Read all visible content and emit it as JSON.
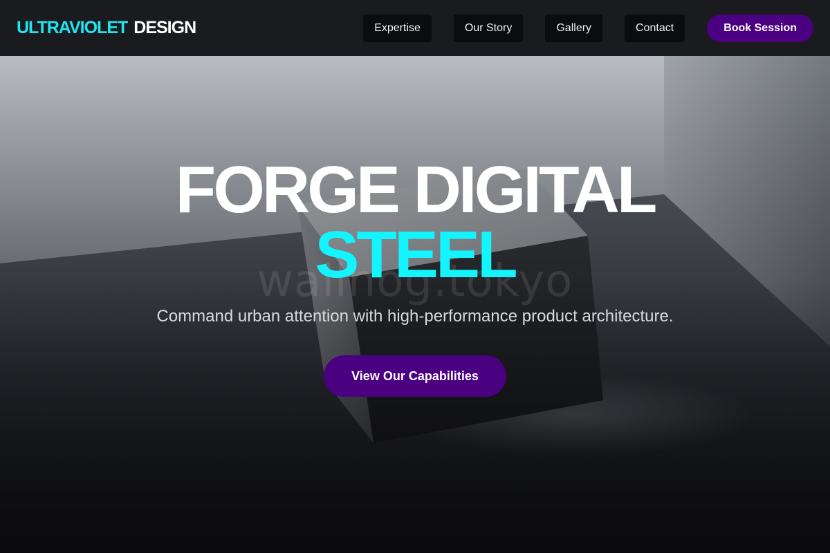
{
  "header": {
    "logo_accent": "ULTRAVIOLET",
    "logo_main": "DESIGN",
    "nav": [
      "Expertise",
      "Our Story",
      "Gallery",
      "Contact"
    ],
    "cta_label": "Book Session"
  },
  "hero": {
    "title_line1": "FORGE DIGITAL",
    "title_line2": "STEEL",
    "watermark": "wallhog.tokyo",
    "subtitle": "Command urban attention with high-performance product architecture.",
    "button_label": "View Our Capabilities"
  },
  "colors": {
    "accent_cyan": "#14f4ff",
    "brand_purple": "#4b0082",
    "header_bg": "#1a1b1f"
  },
  "icons": {}
}
